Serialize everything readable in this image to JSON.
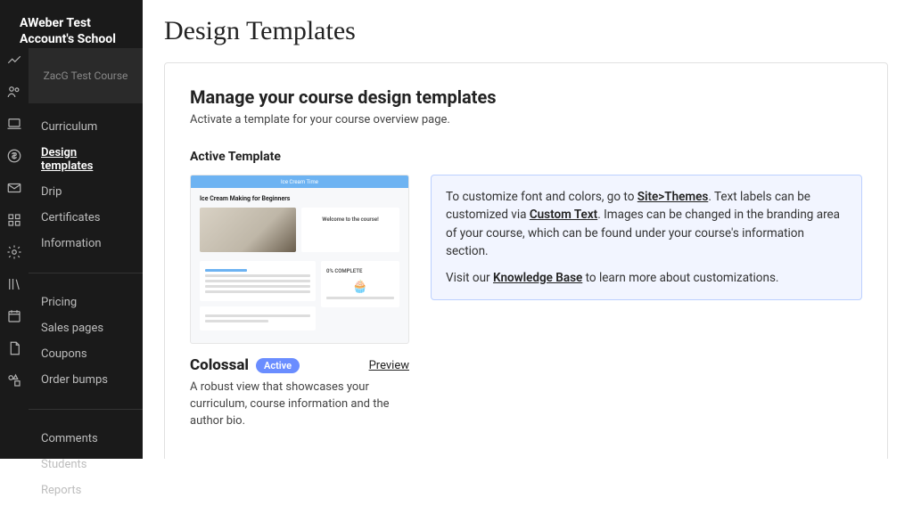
{
  "sidebar": {
    "school_name": "AWeber Test Account's School",
    "course_box": "ZacG Test Course",
    "items": [
      {
        "label": "Curriculum"
      },
      {
        "label": "Design templates"
      },
      {
        "label": "Drip"
      },
      {
        "label": "Certificates"
      },
      {
        "label": "Information"
      }
    ],
    "items2": [
      {
        "label": "Pricing"
      },
      {
        "label": "Sales pages"
      },
      {
        "label": "Coupons"
      },
      {
        "label": "Order bumps"
      }
    ],
    "items3": [
      {
        "label": "Comments"
      },
      {
        "label": "Students"
      },
      {
        "label": "Reports"
      }
    ]
  },
  "page": {
    "title": "Design Templates",
    "card_title": "Manage your course design templates",
    "card_subtitle": "Activate a template for your course overview page.",
    "section_label": "Active Template"
  },
  "preview": {
    "brand": "Ice Cream Time",
    "course_title": "Ice Cream Making for Beginners",
    "welcome": "Welcome to the course!",
    "progress_label": "0% COMPLETE"
  },
  "infobox": {
    "line1_a": "To customize font and colors, go to ",
    "link1": "Site>Themes",
    "line1_b": ". Text labels can be customized via ",
    "link2": "Custom Text",
    "line1_c": ". Images can be changed in the branding area of your course, which can be found under your course's information section.",
    "line2_a": "Visit our ",
    "link3": "Knowledge Base",
    "line2_b": " to learn more about customizations."
  },
  "template": {
    "name": "Colossal",
    "badge": "Active",
    "preview_label": "Preview",
    "description": "A robust view that showcases your curriculum, course information and the author bio."
  }
}
